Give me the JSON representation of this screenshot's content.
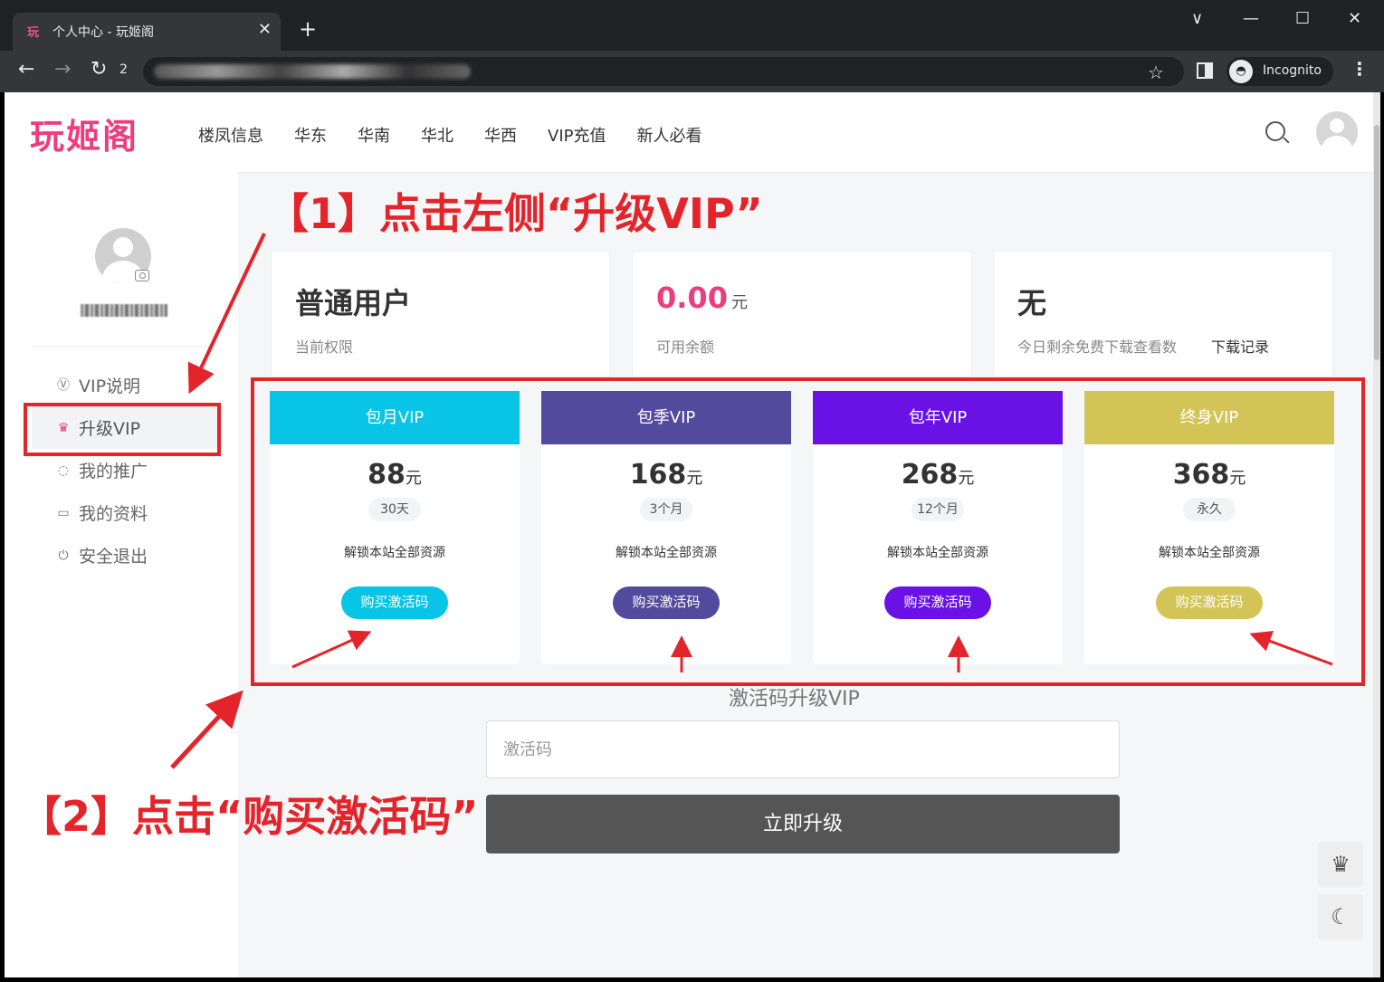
{
  "browser": {
    "tab_favicon": "玩",
    "tab_title": "个人中心 - 玩姬阁",
    "tab_close": "✕",
    "new_tab": "+",
    "reload_badge": "2",
    "incognito_label": "Incognito",
    "window_controls": [
      "∨",
      "—",
      "☐",
      "✕"
    ]
  },
  "site": {
    "logo": "玩姬阁",
    "nav": [
      "楼凤信息",
      "华东",
      "华南",
      "华北",
      "华西",
      "VIP充值",
      "新人必看"
    ]
  },
  "sidebar": {
    "items": [
      {
        "icon": "vip-coin-icon",
        "glyph": "Ⓥ",
        "label": "VIP说明",
        "active": false
      },
      {
        "icon": "crown-icon",
        "glyph": "♛",
        "label": "升级VIP",
        "active": true
      },
      {
        "icon": "refresh-icon",
        "glyph": "◌",
        "label": "我的推广",
        "active": false
      },
      {
        "icon": "id-card-icon",
        "glyph": "▭",
        "label": "我的资料",
        "active": false
      },
      {
        "icon": "power-icon",
        "glyph": "⏻",
        "label": "安全退出",
        "active": false
      }
    ]
  },
  "stats": {
    "role_value": "普通用户",
    "role_label": "当前权限",
    "balance_value": "0.00",
    "balance_unit": "元",
    "balance_label": "可用余额",
    "downloads_value": "无",
    "downloads_label": "今日剩余免费下载查看数",
    "downloads_link": "下载记录"
  },
  "plans": [
    {
      "name": "包月VIP",
      "price": "88",
      "unit": "元",
      "duration": "30天",
      "desc": "解锁本站全部资源",
      "button": "购买激活码",
      "color": "#08c4e6"
    },
    {
      "name": "包季VIP",
      "price": "168",
      "unit": "元",
      "duration": "3个月",
      "desc": "解锁本站全部资源",
      "button": "购买激活码",
      "color": "#524a9c"
    },
    {
      "name": "包年VIP",
      "price": "268",
      "unit": "元",
      "duration": "12个月",
      "desc": "解锁本站全部资源",
      "button": "购买激活码",
      "color": "#6a12e6"
    },
    {
      "name": "终身VIP",
      "price": "368",
      "unit": "元",
      "duration": "永久",
      "desc": "解锁本站全部资源",
      "button": "购买激活码",
      "color": "#d3c457"
    }
  ],
  "activation": {
    "title": "激活码升级VIP",
    "placeholder": "激活码",
    "submit": "立即升级"
  },
  "annotations": {
    "step1": "【1】点击左侧“升级VIP”",
    "step2": "【2】点击“购买激活码”",
    "color": "#e3242b"
  },
  "colors": {
    "brand": "#ee3d7c",
    "chrome_bg": "#202124"
  }
}
